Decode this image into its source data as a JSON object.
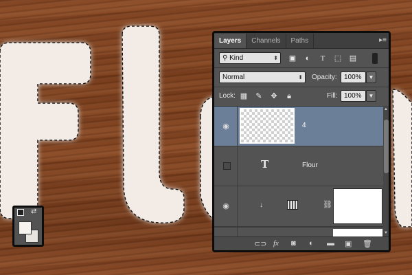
{
  "panel": {
    "tabs": [
      {
        "label": "Layers"
      },
      {
        "label": "Channels"
      },
      {
        "label": "Paths"
      }
    ],
    "filter": {
      "value": "Kind"
    },
    "blend_mode": {
      "value": "Normal"
    },
    "opacity": {
      "label": "Opacity:",
      "value": "100%"
    },
    "lock": {
      "label": "Lock:"
    },
    "fill": {
      "label": "Fill:",
      "value": "100%"
    },
    "layers": [
      {
        "name": "4",
        "selected": true,
        "type": "pixel"
      },
      {
        "name": "Flour",
        "selected": false,
        "type": "text"
      },
      {
        "name": "",
        "selected": false,
        "type": "adjustment"
      }
    ]
  },
  "canvas": {
    "text": "Flour"
  },
  "colors": {
    "panel_bg": "#535353",
    "selected_layer": "#6b7f98",
    "wood": "#7c3f1c",
    "glow_text": "#f3ece6"
  }
}
